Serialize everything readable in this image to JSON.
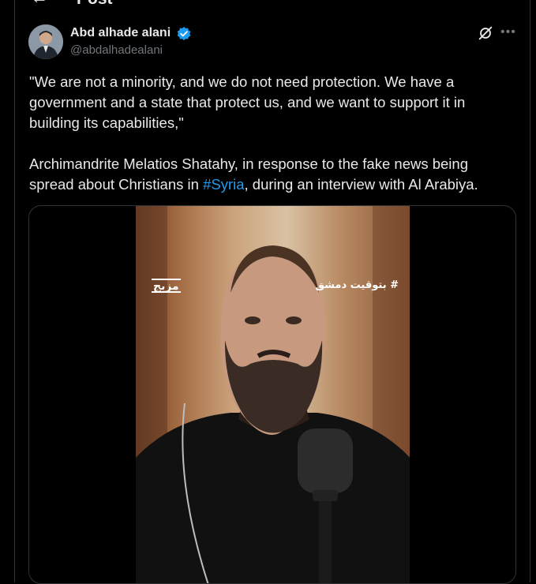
{
  "header": {
    "title": "Post"
  },
  "author": {
    "display_name": "Abd alhade alani",
    "handle": "@abdalhadealani",
    "verified": true
  },
  "post": {
    "paragraph1": "\"We are not a minority, and we do not need protection. We have a government and a state that protect us, and we want to support it in building its capabilities,\"",
    "paragraph2_before": "Archimandrite Melatios Shatahy, in response to the fake news being spread about Christians in ",
    "hashtag": "#Syria",
    "paragraph2_after": ", during an interview with Al Arabiya."
  },
  "media": {
    "watermark_left": "مزيج",
    "watermark_right": "# بتوقيت دمشق"
  },
  "icons": {
    "back": "arrow-left-icon",
    "verified": "verified-badge-icon",
    "grok": "grok-icon",
    "more": "more-icon"
  },
  "colors": {
    "accent": "#1d9bf0",
    "background": "#000000",
    "muted": "#71767b"
  }
}
